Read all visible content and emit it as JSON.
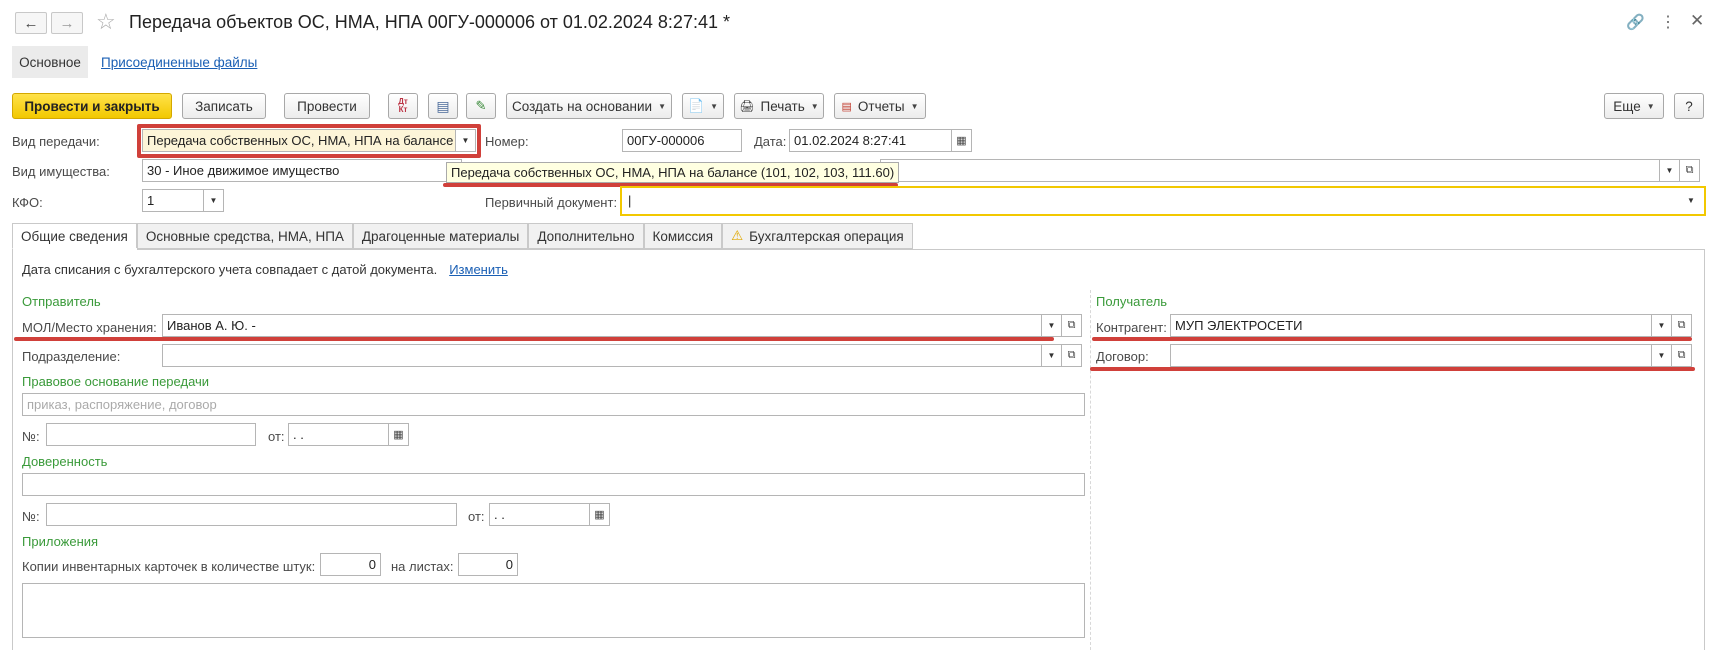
{
  "header": {
    "title": "Передача объектов ОС, НМА, НПА 00ГУ-000006 от 01.02.2024 8:27:41 *"
  },
  "nav_tabs": {
    "main": "Основное",
    "files": "Присоединенные файлы"
  },
  "toolbar": {
    "post_close": "Провести и закрыть",
    "write": "Записать",
    "post": "Провести",
    "dt_kt": "Дт Кт",
    "create_based": "Создать на основании",
    "print": "Печать",
    "reports": "Отчеты",
    "more": "Еще",
    "help": "?"
  },
  "form": {
    "transfer_type_label": "Вид передачи:",
    "transfer_type_value": "Передача собственных ОС, НМА, НПА на балансе",
    "number_label": "Номер:",
    "number_value": "00ГУ-000006",
    "date_label": "Дата:",
    "date_value": "01.02.2024  8:27:41",
    "property_label": "Вид имущества:",
    "property_value": "30 - Иное движимое имущество",
    "tooltip": "Передача собственных ОС, НМА, НПА на балансе (101, 102, 103, 111.60)",
    "kfo_label": "КФО:",
    "kfo_value": "1",
    "primary_doc_label": "Первичный документ:",
    "primary_doc_value": "|"
  },
  "tabs": [
    "Общие сведения",
    "Основные средства, НМА, НПА",
    "Драгоценные материалы",
    "Дополнительно",
    "Комиссия",
    "Бухгалтерская операция"
  ],
  "general": {
    "info_text": "Дата списания с бухгалтерского учета совпадает с датой документа.",
    "change_link": "Изменить",
    "sender_title": "Отправитель",
    "mol_label": "МОЛ/Место хранения:",
    "mol_value": "Иванов А. Ю. -",
    "subdivision_label": "Подразделение:",
    "legal_basis_title": "Правовое основание передачи",
    "legal_basis_placeholder": "приказ, распоряжение, договор",
    "num_label": "№:",
    "from_label": "от:",
    "date_empty": " .  .",
    "poa_title": "Доверенность",
    "attachments_title": "Приложения",
    "copies_label": "Копии инвентарных карточек в количестве штук:",
    "copies_value": "0",
    "sheets_label": "на листах:",
    "sheets_value": "0",
    "recipient_title": "Получатель",
    "counterparty_label": "Контрагент:",
    "counterparty_value": "МУП ЭЛЕКТРОСЕТИ",
    "contract_label": "Договор:"
  },
  "colors": {
    "accent_yellow": "#f2c800",
    "highlight_red": "#d0403a",
    "section_green": "#3a9a3a"
  }
}
